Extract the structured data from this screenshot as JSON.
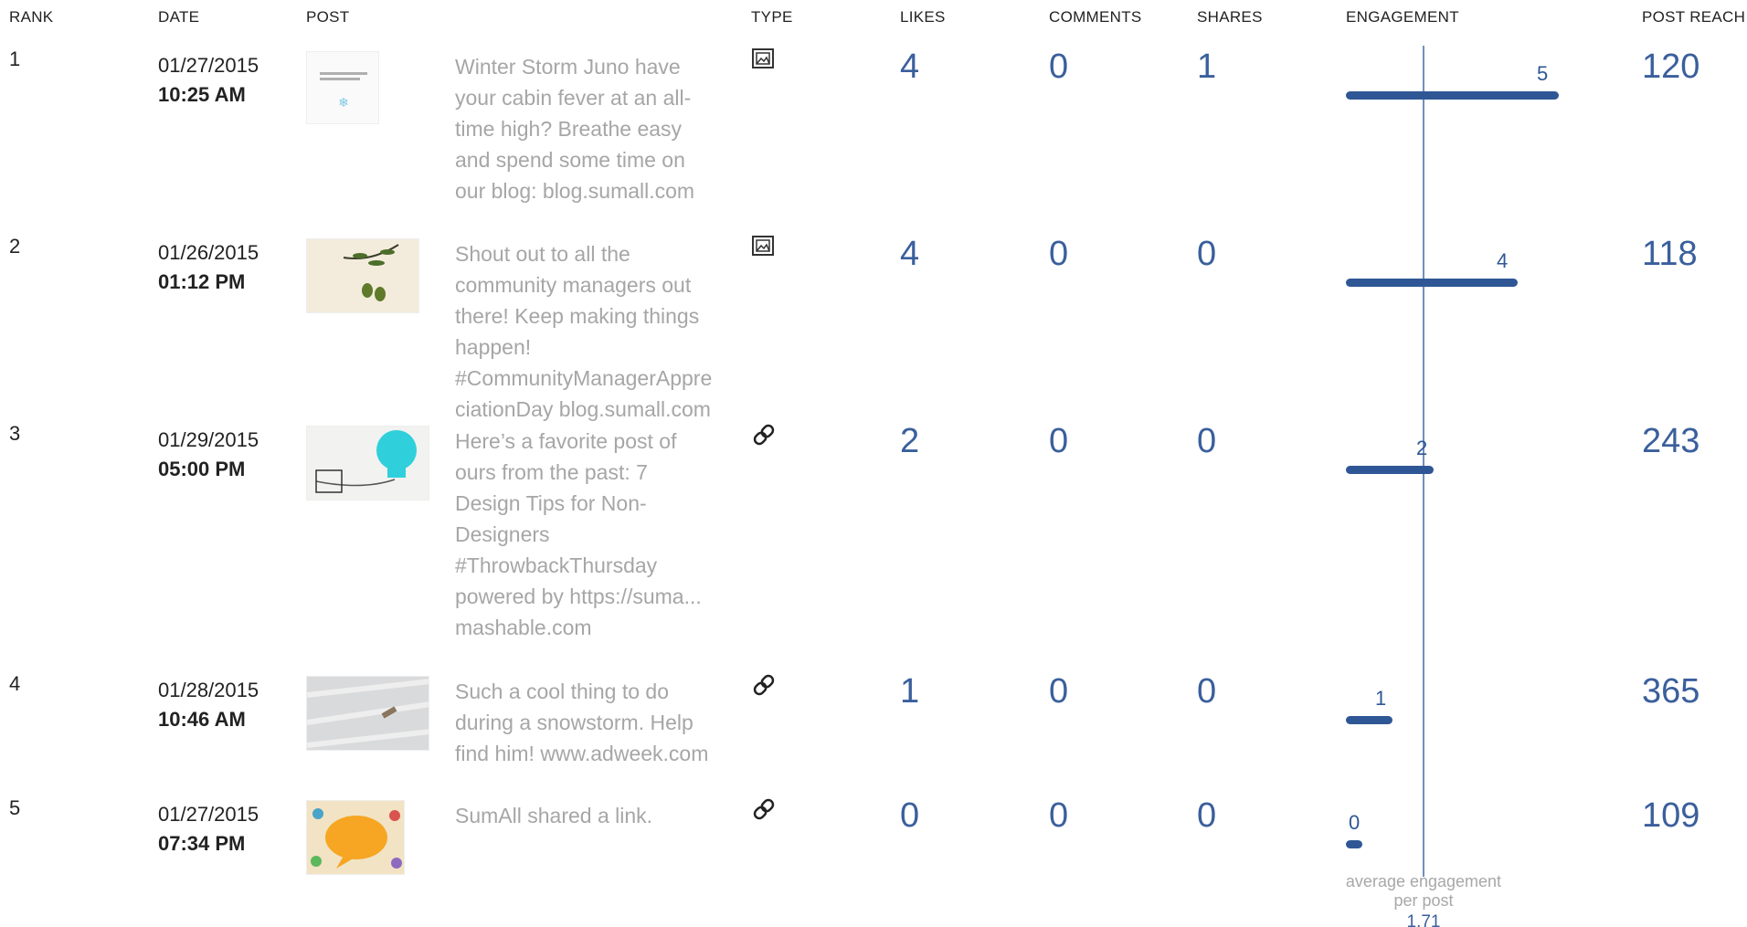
{
  "headers": {
    "rank": "RANK",
    "date": "DATE",
    "post": "POST",
    "type": "TYPE",
    "likes": "LIKES",
    "comments": "COMMENTS",
    "shares": "SHARES",
    "engagement": "ENGAGEMENT",
    "reach": "POST REACH"
  },
  "colors": {
    "accent": "#2f5795",
    "number": "#3a5f9c",
    "post_text": "#a6a6a6"
  },
  "rows": [
    {
      "rank": "1",
      "date": "01/27/2015",
      "time": "10:25 AM",
      "text": "Winter Storm Juno have your cabin fever at an all-time high? Breathe easy and spend some time on our blog: blog.sumall.com",
      "type_icon": "image-icon",
      "likes": "4",
      "comments": "0",
      "shares": "1",
      "engagement": "5",
      "reach": "120"
    },
    {
      "rank": "2",
      "date": "01/26/2015",
      "time": "01:12 PM",
      "text": "Shout out to all the community managers out there! Keep making things happen! #CommunityManagerAppreciationDay blog.sumall.com",
      "type_icon": "image-icon",
      "likes": "4",
      "comments": "0",
      "shares": "0",
      "engagement": "4",
      "reach": "118"
    },
    {
      "rank": "3",
      "date": "01/29/2015",
      "time": "05:00 PM",
      "text": "Here’s a favorite post of ours from the past: 7 Design Tips for Non-Designers #ThrowbackThursday powered by https://suma... mashable.com",
      "type_icon": "link-icon",
      "likes": "2",
      "comments": "0",
      "shares": "0",
      "engagement": "2",
      "reach": "243"
    },
    {
      "rank": "4",
      "date": "01/28/2015",
      "time": "10:46 AM",
      "text": "Such a cool thing to do during a snowstorm. Help find him! www.adweek.com",
      "type_icon": "link-icon",
      "likes": "1",
      "comments": "0",
      "shares": "0",
      "engagement": "1",
      "reach": "365"
    },
    {
      "rank": "5",
      "date": "01/27/2015",
      "time": "07:34 PM",
      "text": "SumAll shared a link.",
      "type_icon": "link-icon",
      "likes": "0",
      "comments": "0",
      "shares": "0",
      "engagement": "0",
      "reach": "109"
    }
  ],
  "average": {
    "caption_line1": "average engagement",
    "caption_line2": "per post",
    "value": "1.71"
  },
  "chart_data": {
    "type": "bar",
    "categories": [
      "1",
      "2",
      "3",
      "4",
      "5"
    ],
    "values": [
      5,
      4,
      2,
      1,
      0
    ],
    "average": 1.71
  }
}
